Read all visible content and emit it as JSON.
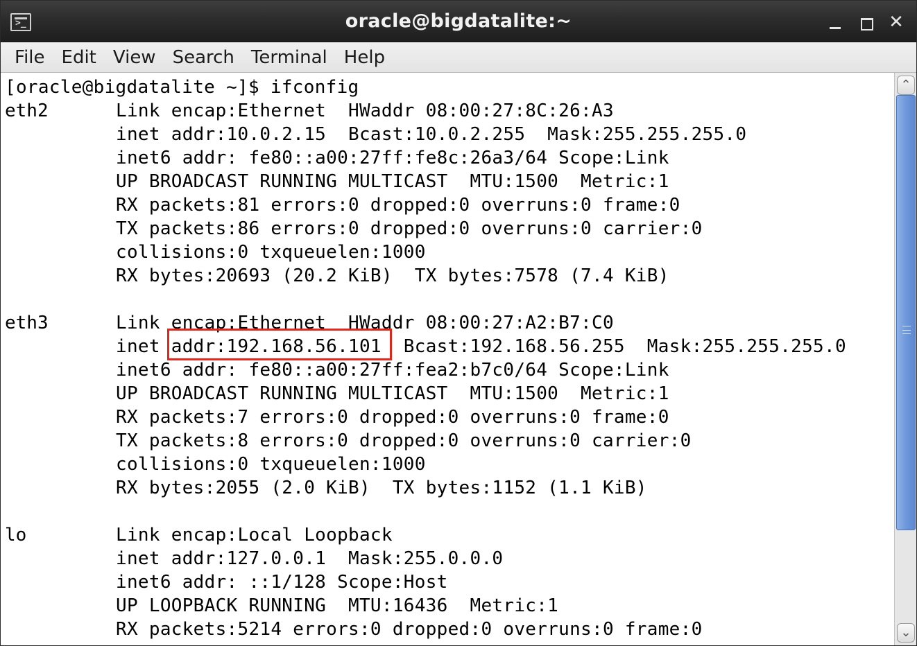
{
  "window": {
    "title": "oracle@bigdatalite:~",
    "app_icon": "terminal-icon",
    "app_icon_glyph": ">_",
    "controls": [
      "minimize",
      "maximize",
      "close"
    ],
    "close_glyph": "✕"
  },
  "menu": [
    "File",
    "Edit",
    "View",
    "Search",
    "Terminal",
    "Help"
  ],
  "terminal": {
    "prompt_line": "[oracle@bigdatalite ~]$ ifconfig",
    "interfaces": [
      {
        "name": "eth2",
        "lines": [
          "Link encap:Ethernet  HWaddr 08:00:27:8C:26:A3",
          "inet addr:10.0.2.15  Bcast:10.0.2.255  Mask:255.255.255.0",
          "inet6 addr: fe80::a00:27ff:fe8c:26a3/64 Scope:Link",
          "UP BROADCAST RUNNING MULTICAST  MTU:1500  Metric:1",
          "RX packets:81 errors:0 dropped:0 overruns:0 frame:0",
          "TX packets:86 errors:0 dropped:0 overruns:0 carrier:0",
          "collisions:0 txqueuelen:1000",
          "RX bytes:20693 (20.2 KiB)  TX bytes:7578 (7.4 KiB)"
        ]
      },
      {
        "name": "eth3",
        "lines": [
          "Link encap:Ethernet  HWaddr 08:00:27:A2:B7:C0",
          "inet addr:192.168.56.101  Bcast:192.168.56.255  Mask:255.255.255.0",
          "inet6 addr: fe80::a00:27ff:fea2:b7c0/64 Scope:Link",
          "UP BROADCAST RUNNING MULTICAST  MTU:1500  Metric:1",
          "RX packets:7 errors:0 dropped:0 overruns:0 frame:0",
          "TX packets:8 errors:0 dropped:0 overruns:0 carrier:0",
          "collisions:0 txqueuelen:1000",
          "RX bytes:2055 (2.0 KiB)  TX bytes:1152 (1.1 KiB)"
        ]
      },
      {
        "name": "lo",
        "lines": [
          "Link encap:Local Loopback",
          "inet addr:127.0.0.1  Mask:255.0.0.0",
          "inet6 addr: ::1/128 Scope:Host",
          "UP LOOPBACK RUNNING  MTU:16436  Metric:1",
          "RX packets:5214 errors:0 dropped:0 overruns:0 frame:0"
        ]
      }
    ],
    "highlight": {
      "annotated_text": "addr:192.168.56.101",
      "color": "#e1261c"
    }
  },
  "scrollbar": {
    "up_glyph": "⌃",
    "down_glyph": "⌄",
    "thumb_color": "#6e98db"
  }
}
